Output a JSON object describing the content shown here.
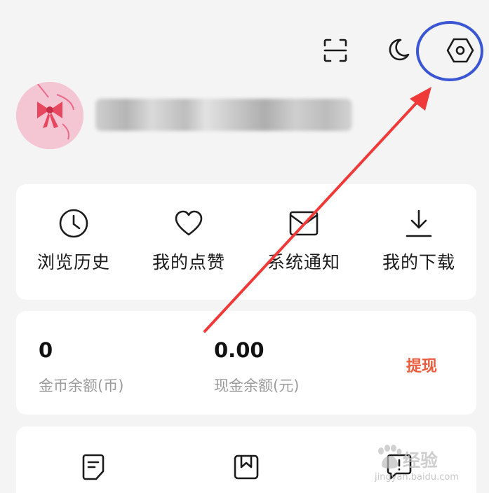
{
  "topbar": {
    "icons": [
      "scan-icon",
      "night-mode-icon",
      "settings-icon"
    ]
  },
  "profile": {
    "avatar": "avatar-pink-bow",
    "username_obscured": true
  },
  "quick_actions": [
    {
      "label": "浏览历史",
      "icon": "clock-icon"
    },
    {
      "label": "我的点赞",
      "icon": "heart-icon"
    },
    {
      "label": "系统通知",
      "icon": "envelope-icon"
    },
    {
      "label": "我的下载",
      "icon": "download-icon"
    }
  ],
  "wallet": {
    "coin_balance": "0",
    "coin_label": "金币余额(币)",
    "cash_balance": "0.00",
    "cash_label": "现金余额(元)",
    "withdraw_label": "提现"
  },
  "tools": {
    "icons": [
      "note-icon",
      "book-icon",
      "feedback-icon"
    ]
  },
  "annotation": {
    "highlight_color": "#3a56d4",
    "arrow_color": "#f03a3a",
    "target": "settings-icon"
  },
  "watermark": {
    "main": "经验",
    "sub": "jingyan.baidu.com"
  },
  "colors": {
    "background": "#f4f4f4",
    "card": "#ffffff",
    "accent": "#ea5c3c",
    "muted_text": "#9a9a9a"
  }
}
